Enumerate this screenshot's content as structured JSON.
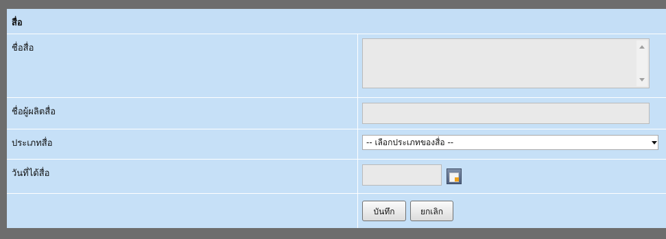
{
  "header": {
    "title": "สื่อ"
  },
  "fields": {
    "media_name_label": "ชื่อสื่อ",
    "producer_label": "ชื่อผู้ผลิตสื่อ",
    "media_type_label": "ประเภทสื่อ",
    "media_type_select": {
      "selected": "-- เลือกประเภทของสื่อ --"
    },
    "date_received_label": "วันที่ได้สื่อ"
  },
  "buttons": {
    "save_label": "บันทึก",
    "cancel_label": "ยกเลิก"
  },
  "icons": {
    "calendar": "calendar-icon",
    "scroll_up": "scroll-up-arrow-icon",
    "scroll_down": "scroll-down-arrow-icon",
    "dropdown": "chevron-down-icon"
  },
  "colors": {
    "panel_bg": "#c6e0f7",
    "frame": "#6d6d6d",
    "input_bg": "#e9e9e9"
  }
}
